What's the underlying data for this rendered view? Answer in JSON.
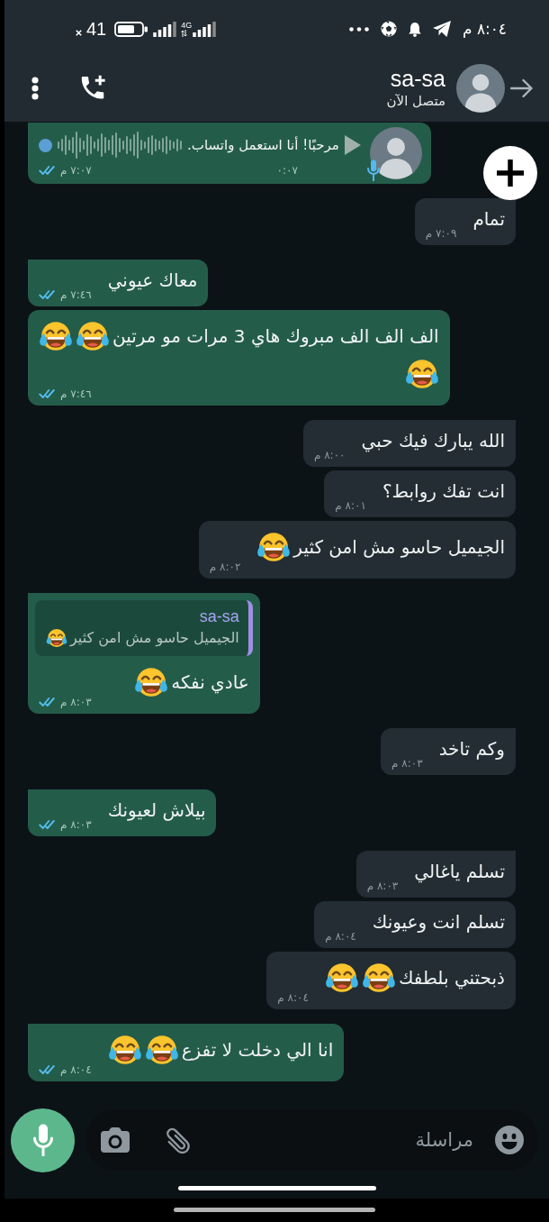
{
  "status_bar": {
    "battery": "41",
    "network": "4G",
    "time": "٨:٠٤ م"
  },
  "header": {
    "name": "sa-sa",
    "status": "متصل الآن"
  },
  "messages": [
    {
      "kind": "voice",
      "outgoing": true,
      "transcript": "مرحبًا! أنا استعمل واتساب.",
      "duration": "٠:٠٧",
      "time": "٧:٠٧ م",
      "read": true
    },
    {
      "kind": "text",
      "outgoing": false,
      "lines": [
        [
          {
            "kind": "text",
            "text": "تمام"
          }
        ]
      ],
      "time": "٧:٠٩ م"
    },
    {
      "kind": "text",
      "outgoing": true,
      "lines": [
        [
          {
            "kind": "text",
            "text": "معاك عيوني"
          }
        ]
      ],
      "time": "٧:٤٦ م",
      "read": true
    },
    {
      "kind": "text",
      "outgoing": true,
      "lines": [
        [
          {
            "kind": "text",
            "text": "الف الف الف مبروك هاي 3 مرات مو مرتين"
          },
          {
            "kind": "emoji"
          },
          {
            "kind": "emoji"
          }
        ],
        [
          {
            "kind": "emoji"
          }
        ]
      ],
      "time": "٧:٤٦ م",
      "read": true
    },
    {
      "kind": "text",
      "outgoing": false,
      "lines": [
        [
          {
            "kind": "text",
            "text": "الله يبارك فيك حبي"
          }
        ]
      ],
      "time": "٨:٠٠ م"
    },
    {
      "kind": "text",
      "outgoing": false,
      "lines": [
        [
          {
            "kind": "text",
            "text": "انت تفك روابط؟"
          }
        ]
      ],
      "time": "٨:٠١ م"
    },
    {
      "kind": "text",
      "outgoing": false,
      "lines": [
        [
          {
            "kind": "text",
            "text": "الجيميل حاسو مش امن كثير"
          },
          {
            "kind": "emoji"
          }
        ]
      ],
      "time": "٨:٠٢ م"
    },
    {
      "kind": "reply",
      "outgoing": true,
      "quote": {
        "author": "sa-sa",
        "lines": [
          [
            {
              "kind": "text",
              "text": "الجيميل حاسو مش امن كثير"
            },
            {
              "kind": "emoji"
            }
          ]
        ]
      },
      "lines": [
        [
          {
            "kind": "text",
            "text": "عادي نفكه"
          },
          {
            "kind": "emoji"
          }
        ]
      ],
      "time": "٨:٠٣ م",
      "read": true
    },
    {
      "kind": "text",
      "outgoing": false,
      "lines": [
        [
          {
            "kind": "text",
            "text": "وكم تاخد"
          }
        ]
      ],
      "time": "٨:٠٣ م"
    },
    {
      "kind": "text",
      "outgoing": true,
      "lines": [
        [
          {
            "kind": "text",
            "text": "بيلاش لعيونك"
          }
        ]
      ],
      "time": "٨:٠٣ م",
      "read": true
    },
    {
      "kind": "text",
      "outgoing": false,
      "lines": [
        [
          {
            "kind": "text",
            "text": "تسلم ياغالي"
          }
        ]
      ],
      "time": "٨:٠٣ م"
    },
    {
      "kind": "text",
      "outgoing": false,
      "lines": [
        [
          {
            "kind": "text",
            "text": "تسلم انت وعيونك"
          }
        ]
      ],
      "time": "٨:٠٤ م"
    },
    {
      "kind": "text",
      "outgoing": false,
      "lines": [
        [
          {
            "kind": "text",
            "text": "ذبحتني بلطفك"
          },
          {
            "kind": "emoji"
          },
          {
            "kind": "emoji"
          }
        ]
      ],
      "time": "٨:٠٤ م"
    },
    {
      "kind": "text",
      "outgoing": true,
      "lines": [
        [
          {
            "kind": "text",
            "text": "انا الي دخلت لا تفزع"
          },
          {
            "kind": "emoji"
          },
          {
            "kind": "emoji"
          }
        ]
      ],
      "time": "٨:٠٤ م",
      "read": true
    }
  ],
  "composer": {
    "placeholder": "مراسلة"
  }
}
